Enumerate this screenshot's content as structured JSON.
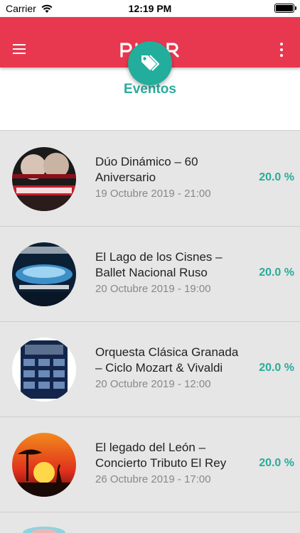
{
  "status_bar": {
    "carrier": "Carrier",
    "time": "12:19 PM"
  },
  "app_bar": {
    "menu_icon": "hamburger-menu-icon",
    "logo_text": "PUGR",
    "more_icon": "more-vertical-icon"
  },
  "header": {
    "title": "Eventos",
    "fab_icon": "tags-icon"
  },
  "events": [
    {
      "title": "Dúo Dinámico – 60 Aniversario",
      "date": "19 Octubre 2019 - 21:00",
      "discount": "20.0 %"
    },
    {
      "title": "El Lago de los Cisnes – Ballet Nacional Ruso",
      "date": "20 Octubre 2019 - 19:00",
      "discount": "20.0 %"
    },
    {
      "title": "Orquesta Clásica Granada – Ciclo Mozart & Vivaldi",
      "date": "20 Octubre 2019 - 12:00",
      "discount": "20.0 %"
    },
    {
      "title": "El legado del León – Concierto Tributo El Rey",
      "date": "26 Octubre 2019 - 17:00",
      "discount": "20.0 %"
    }
  ],
  "colors": {
    "brand_red": "#e8384f",
    "accent_teal": "#2aab9b",
    "list_bg": "#e6e6e6"
  }
}
